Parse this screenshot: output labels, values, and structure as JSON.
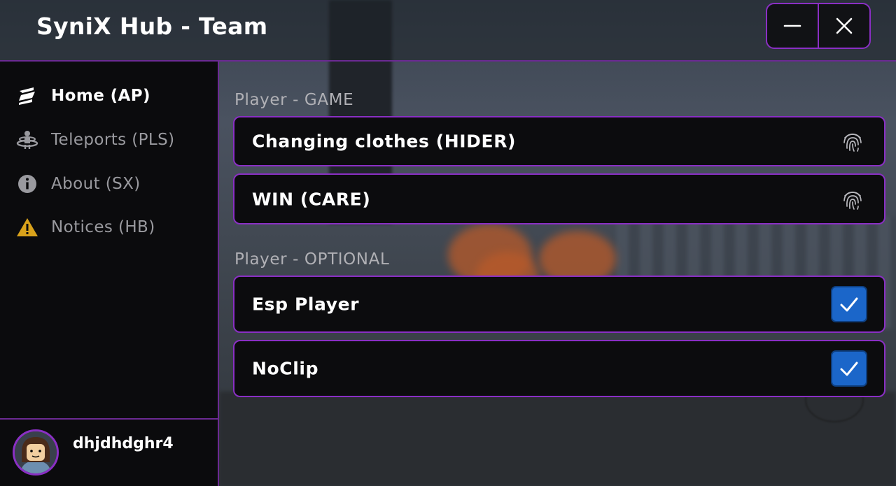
{
  "window": {
    "title": "SyniX Hub - Team",
    "minimize_icon": "minimize-icon",
    "close_icon": "close-icon"
  },
  "sidebar": {
    "items": [
      {
        "label": "Home (AP)",
        "icon": "home-icon",
        "active": true
      },
      {
        "label": "Teleports (PLS)",
        "icon": "teleport-icon",
        "active": false
      },
      {
        "label": "About (SX)",
        "icon": "info-icon",
        "active": false
      },
      {
        "label": "Notices (HB)",
        "icon": "warning-icon",
        "active": false
      }
    ],
    "user": {
      "name": "dhjdhdghr4",
      "avatar": "avatar"
    }
  },
  "main": {
    "sections": [
      {
        "title": "Player - GAME",
        "rows": [
          {
            "label": "Changing clothes (HIDER)",
            "icon": "fingerprint-icon"
          },
          {
            "label": "WIN (CARE)",
            "icon": "fingerprint-icon"
          }
        ]
      },
      {
        "title": "Player - OPTIONAL",
        "rows": [
          {
            "label": "Esp Player",
            "checked": true
          },
          {
            "label": "NoClip",
            "checked": true
          }
        ]
      }
    ]
  },
  "colors": {
    "accent": "#8a2fc4",
    "checkbox": "#1b66c9",
    "warning": "#d9a21b"
  }
}
